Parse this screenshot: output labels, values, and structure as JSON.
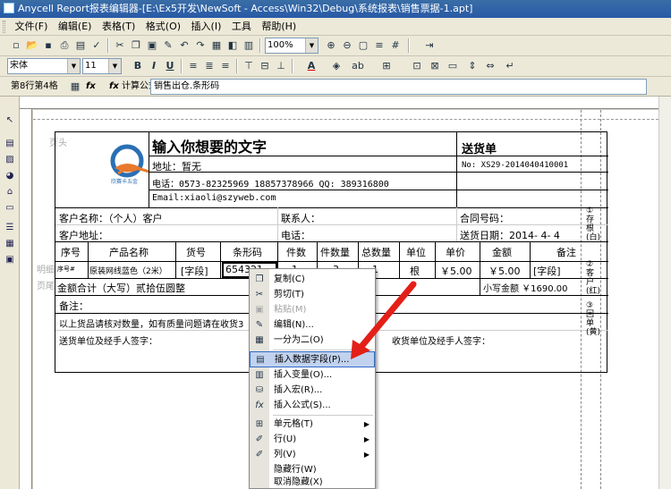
{
  "window": {
    "title": "Anycell Report报表编辑器-[E:\\Ex5开发\\NewSoft - Access\\Win32\\Debug\\系统报表\\销售票据-1.apt]"
  },
  "menu": [
    "文件(F)",
    "编辑(E)",
    "表格(T)",
    "格式(O)",
    "插入(I)",
    "工具",
    "帮助(H)"
  ],
  "toolbar": {
    "zoom": "100%",
    "font_name": "宋体",
    "font_size": "11",
    "bold": "B",
    "italic": "I",
    "underline": "U",
    "font_color_glyph": "A"
  },
  "formula_bar": {
    "cell_position": "第8行第4格",
    "fx": "fx",
    "label": "计算公式=",
    "value": "销售出仓.条形码"
  },
  "report": {
    "header_band": "页头",
    "title": "输入你想要的文字",
    "address": "地址：暂无",
    "phone": "电话：0573-82325969 18857378966 QQ: 389316800",
    "email": "Email:xiaoli@szyweb.com",
    "doc_type": "送货单",
    "doc_no": "No: XS29-2014040410001",
    "customer_name": "客户名称：（个人）客户",
    "contact": "联系人：",
    "contract_no": "合同号码：",
    "customer_address": "客户地址：",
    "customer_phone": "电话：",
    "delivery_date": "送货日期：2014- 4- 4",
    "columns": [
      "序号",
      "产品名称",
      "货号",
      "条形码",
      "件数",
      "件数量",
      "总数量",
      "单位",
      "单价",
      "金额",
      "备注"
    ],
    "row": {
      "seq": "序号#",
      "product": "原装网线蓝色（2米）",
      "code": "[字段]",
      "barcode": "654321",
      "pieces": "1",
      "piece_qty": "3",
      "total_qty": "1",
      "unit": "根",
      "price": "￥5.00",
      "amount": "￥5.00",
      "note": "[字段]"
    },
    "row_band": "明细",
    "total_band": "页尾",
    "total_upper": "金额合计（大写）贰拾伍圆整",
    "total_small": "小写金额 ￥1690.00",
    "remark": "备注：",
    "notice": "以上货品请核对数量，如有质量问题请在收货3",
    "sender_sign": "送货单位及经手人签字：",
    "receiver_sign": "收货单位及经手人签字：",
    "side_labels": [
      "①存根(白)",
      "②客户(红)",
      "③回单(黄)"
    ],
    "logo_text": "欣赛卡五金"
  },
  "context_menu": [
    {
      "label": "复制(C)",
      "icon": "copy-icon",
      "disabled": false
    },
    {
      "label": "剪切(T)",
      "icon": "cut-icon",
      "disabled": false
    },
    {
      "label": "粘贴(M)",
      "icon": "paste-icon",
      "disabled": true
    },
    {
      "label": "编辑(N)...",
      "icon": "edit-icon",
      "disabled": false
    },
    {
      "label": "一分为二(O)",
      "icon": "split-icon",
      "disabled": false
    },
    {
      "label": "插入数据字段(P)...",
      "icon": "insert-field-icon",
      "disabled": false,
      "selected": true
    },
    {
      "label": "插入变量(O)...",
      "icon": "insert-variable-icon",
      "disabled": false
    },
    {
      "label": "插入宏(R)...",
      "icon": "insert-macro-icon",
      "disabled": false
    },
    {
      "label": "插入公式(S)...",
      "icon": "insert-formula-icon",
      "disabled": false
    },
    {
      "label": "单元格(T)",
      "icon": "cell-icon",
      "submenu": true
    },
    {
      "label": "行(U)",
      "icon": "row-icon",
      "submenu": true
    },
    {
      "label": "列(V)",
      "icon": "column-icon",
      "submenu": true
    },
    {
      "label": "隐藏行(W)",
      "icon": "",
      "disabled": false
    },
    {
      "label": "取消隐藏(X)",
      "icon": "",
      "disabled": false
    }
  ],
  "colors": {
    "title_bar": "#2859a7",
    "menu_selection": "#c1d2ee",
    "arrow": "#e32018"
  }
}
